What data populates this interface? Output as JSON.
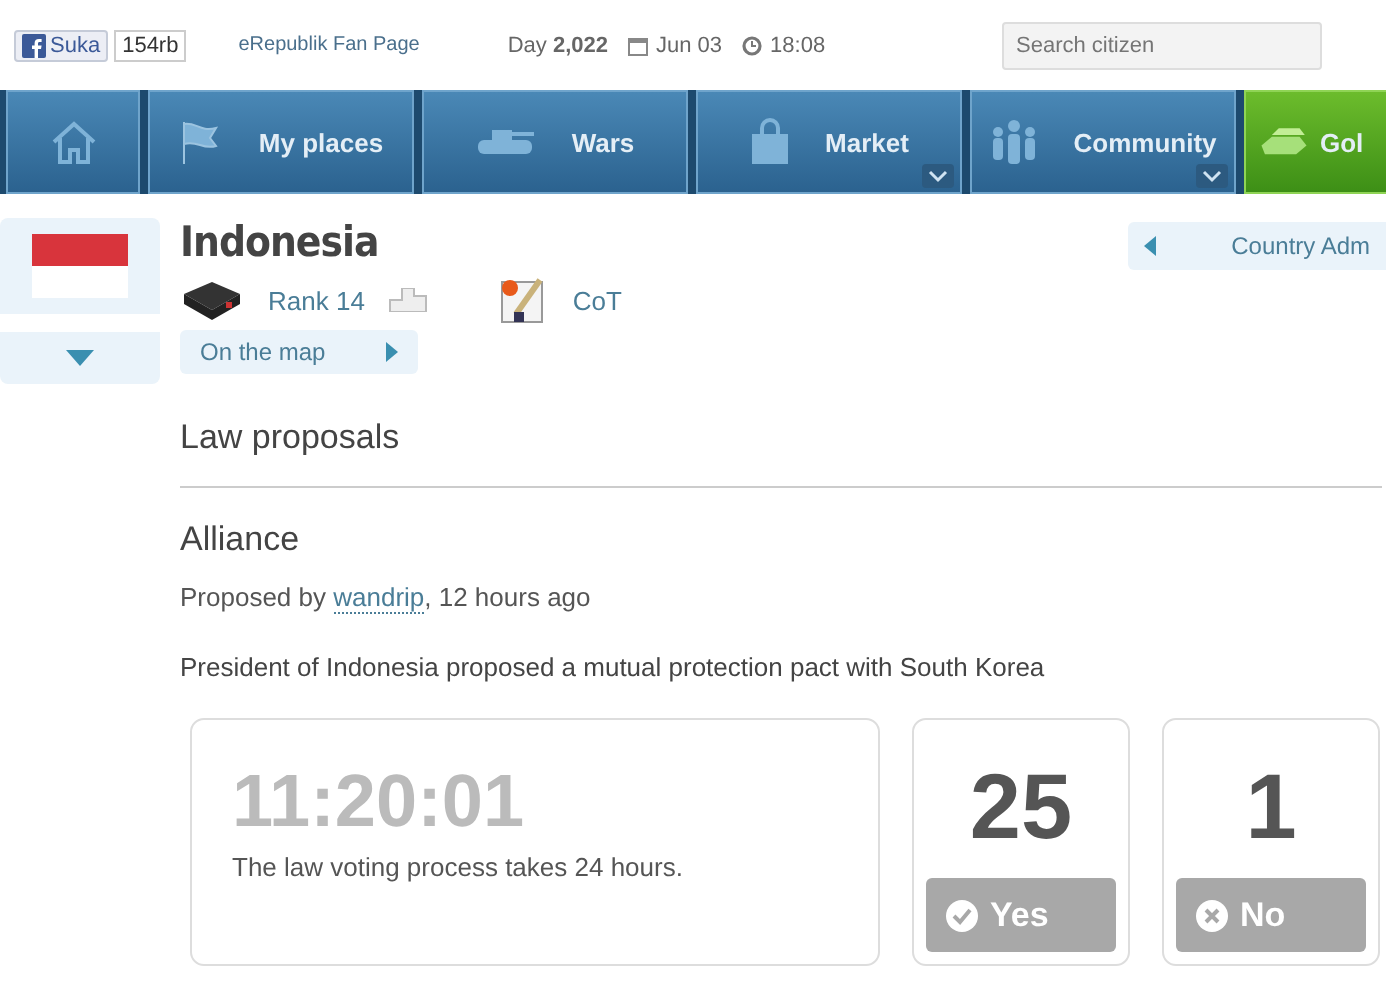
{
  "header": {
    "like_label": "Suka",
    "like_count": "154rb",
    "fan_page": "eRepublik Fan Page",
    "day_label": "Day",
    "day": "2,022",
    "date": "Jun 03",
    "time": "18:08",
    "search": {
      "placeholder": "Search citizen"
    }
  },
  "nav": [
    {
      "kind": "home",
      "dropdown": false
    },
    {
      "kind": "places",
      "label": "My places",
      "dropdown": false
    },
    {
      "kind": "wars",
      "label": "Wars",
      "dropdown": false
    },
    {
      "kind": "market",
      "label": "Market",
      "dropdown": true
    },
    {
      "kind": "community",
      "label": "Community",
      "dropdown": true
    },
    {
      "kind": "gold",
      "label": "Gol"
    }
  ],
  "country": {
    "name": "Indonesia",
    "rank": "Rank 14",
    "cot": "CoT",
    "map_link": "On the map",
    "admin_link": "Country Adm"
  },
  "section_title": "Law proposals",
  "proposal": {
    "title": "Alliance",
    "proposed_prefix": "Proposed by",
    "author": "wandrip",
    "proposed_suffix": ", 12 hours ago",
    "description": "President of Indonesia proposed a mutual protection pact with South Korea",
    "countdown": "11:20:01",
    "note": "The law voting process takes 24 hours.",
    "votes": [
      {
        "kind": "yes",
        "count": "25",
        "label": "Yes"
      },
      {
        "kind": "no",
        "count": "1",
        "label": "No"
      }
    ]
  }
}
